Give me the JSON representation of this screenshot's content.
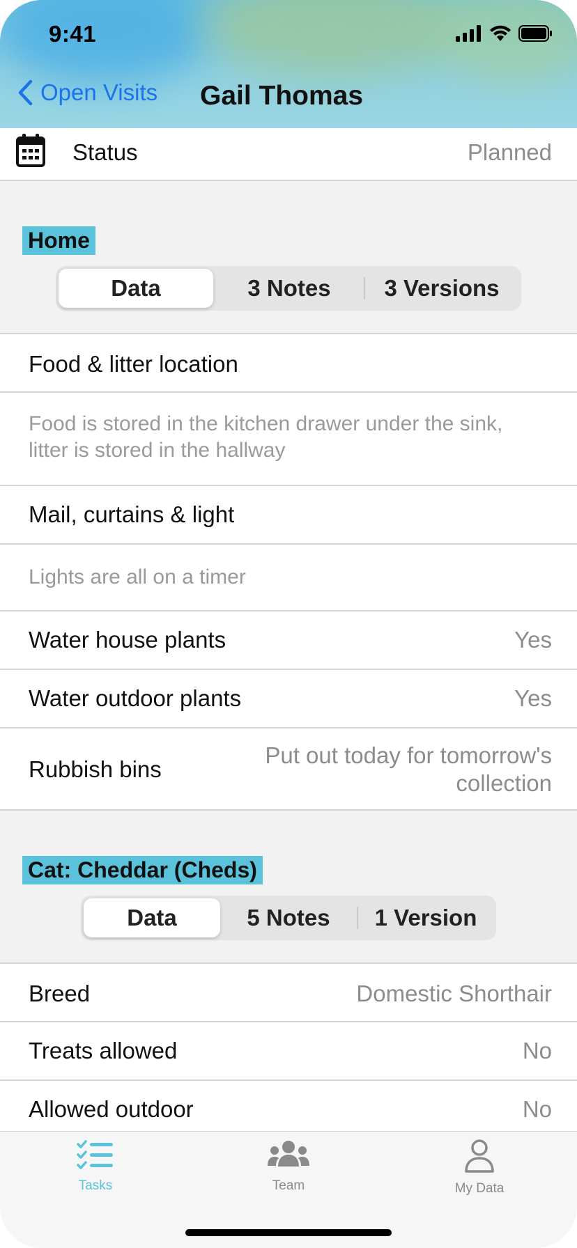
{
  "status_bar": {
    "time": "9:41"
  },
  "nav": {
    "back_label": "Open Visits",
    "title": "Gail Thomas"
  },
  "status_row": {
    "label": "Status",
    "value": "Planned",
    "icon": "calendar-icon"
  },
  "home": {
    "title": "Home",
    "segments": [
      "Data",
      "3 Notes",
      "3 Versions"
    ],
    "selected": "Data",
    "rows": [
      {
        "label": "Food & litter location"
      },
      {
        "note": "Food is stored in the kitchen drawer under the sink, litter is stored in the hallway"
      },
      {
        "label": "Mail, curtains & light"
      },
      {
        "note": "Lights are all on a timer"
      },
      {
        "label": "Water house plants",
        "value": "Yes"
      },
      {
        "label": "Water outdoor plants",
        "value": "Yes"
      },
      {
        "label": "Rubbish bins",
        "value_line1": "Put out today for tomorrow's",
        "value_line2": "collection"
      }
    ]
  },
  "cat": {
    "title": "Cat: Cheddar (Cheds)",
    "segments": [
      "Data",
      "5 Notes",
      "1 Version"
    ],
    "selected": "Data",
    "rows": [
      {
        "label": "Breed",
        "value": "Domestic Shorthair"
      },
      {
        "label": "Treats allowed",
        "value": "No"
      },
      {
        "label": "Allowed outdoor",
        "value": "No"
      }
    ]
  },
  "tabbar": {
    "items": [
      {
        "label": "Tasks",
        "icon": "checklist-icon",
        "active": true
      },
      {
        "label": "Team",
        "icon": "team-icon",
        "active": false
      },
      {
        "label": "My Data",
        "icon": "person-icon",
        "active": false
      }
    ]
  },
  "colors": {
    "accent": "#5bc2dc",
    "link": "#1a73e8",
    "secondary_text": "#8c8c8c"
  }
}
